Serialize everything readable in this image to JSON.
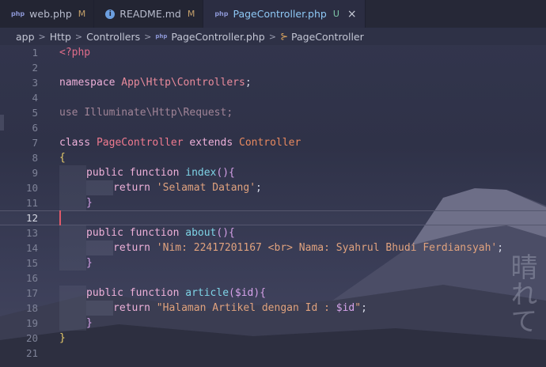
{
  "tabs": [
    {
      "icon": "php-file-icon",
      "icon_text": "php",
      "label": "web.php",
      "flag": "M",
      "active": false
    },
    {
      "icon": "info-icon",
      "icon_text": "i",
      "label": "README.md",
      "flag": "M",
      "active": false
    },
    {
      "icon": "php-file-icon",
      "icon_text": "php",
      "label": "PageController.php",
      "flag": "U",
      "active": true,
      "close": "×"
    }
  ],
  "breadcrumb": {
    "items": [
      "app",
      "Http",
      "Controllers",
      "PageController.php",
      "PageController"
    ],
    "file_icon_text": "php",
    "class_icon": "⊱"
  },
  "editor": {
    "current_line": 12,
    "line_numbers": [
      "1",
      "2",
      "3",
      "4",
      "5",
      "6",
      "7",
      "8",
      "9",
      "10",
      "11",
      "12",
      "13",
      "14",
      "15",
      "16",
      "17",
      "18",
      "19",
      "20",
      "21"
    ]
  },
  "code": {
    "l1": "<?php",
    "l3_kw": "namespace",
    "l3_ns": "App\\Http\\Controllers",
    "l3_semi": ";",
    "l5_kw": "use",
    "l5_ns": "Illuminate\\Http\\Request",
    "l5_semi": ";",
    "l7_kw": "class",
    "l7_cls": "PageController",
    "l7_ext": "extends",
    "l7_base": "Controller",
    "open_brace": "{",
    "close_brace": "}",
    "public": "public",
    "function": "function",
    "return": "return",
    "m1_name": "index",
    "m1_params": "()",
    "m1_open": "{",
    "m1_ret": "'Selamat Datang'",
    "m2_name": "about",
    "m2_params": "()",
    "m2_open": "{",
    "m2_ret": "'Nim: 22417201167 <br> Nama: Syahrul Bhudi Ferdiansyah'",
    "m3_name": "article",
    "m3_paren_open": "(",
    "m3_param": "$id",
    "m3_paren_close": ")",
    "m3_open": "{",
    "m3_ret_a": "\"Halaman Artikel dengan Id : ",
    "m3_ret_var": "$id",
    "m3_ret_b": "\"",
    "semi": ";",
    "space": " "
  },
  "watermark": "晴れて"
}
